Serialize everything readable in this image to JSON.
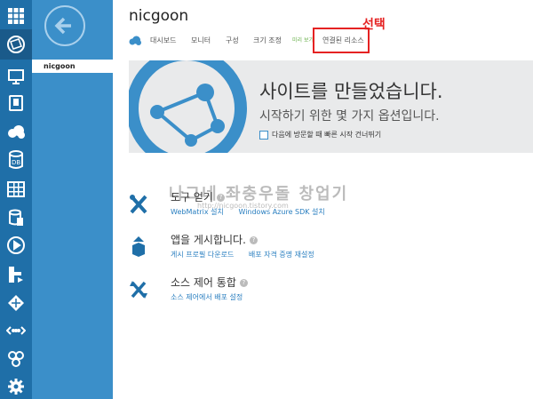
{
  "site_title": "nicgoon",
  "subnav": {
    "selected_item": "nicgoon"
  },
  "tabs": [
    "대시보드",
    "모니터",
    "구성",
    "크기 조정",
    "미리 보기",
    "연결된 리소스"
  ],
  "annotation_label": "선택",
  "hero": {
    "title": "사이트를 만들었습니다.",
    "subtitle": "시작하기 위한 몇 가지 옵션입니다.",
    "checkbox_label": "다음에 방문할 때 빠른 시작 건너뛰기"
  },
  "actions": [
    {
      "title": "도구 얻기",
      "links": [
        "WebMatrix 설치",
        "Windows Azure SDK 설치"
      ]
    },
    {
      "title": "앱을 게시합니다.",
      "links": [
        "게시 프로필 다운로드",
        "배포 자격 증명 재설정"
      ]
    },
    {
      "title": "소스 제어 통합",
      "links": [
        "소스 제어에서 배포 설정"
      ]
    }
  ],
  "watermark": {
    "line1": "나그네 좌충우돌 창업기",
    "line2": "http://nicgoon.tistory.com"
  },
  "colors": {
    "iconbar": "#1f6fa8",
    "subnav": "#3b8fc9",
    "highlight": "#e52222",
    "hero_bg": "#e9eaeb",
    "link": "#2a7fc0"
  }
}
